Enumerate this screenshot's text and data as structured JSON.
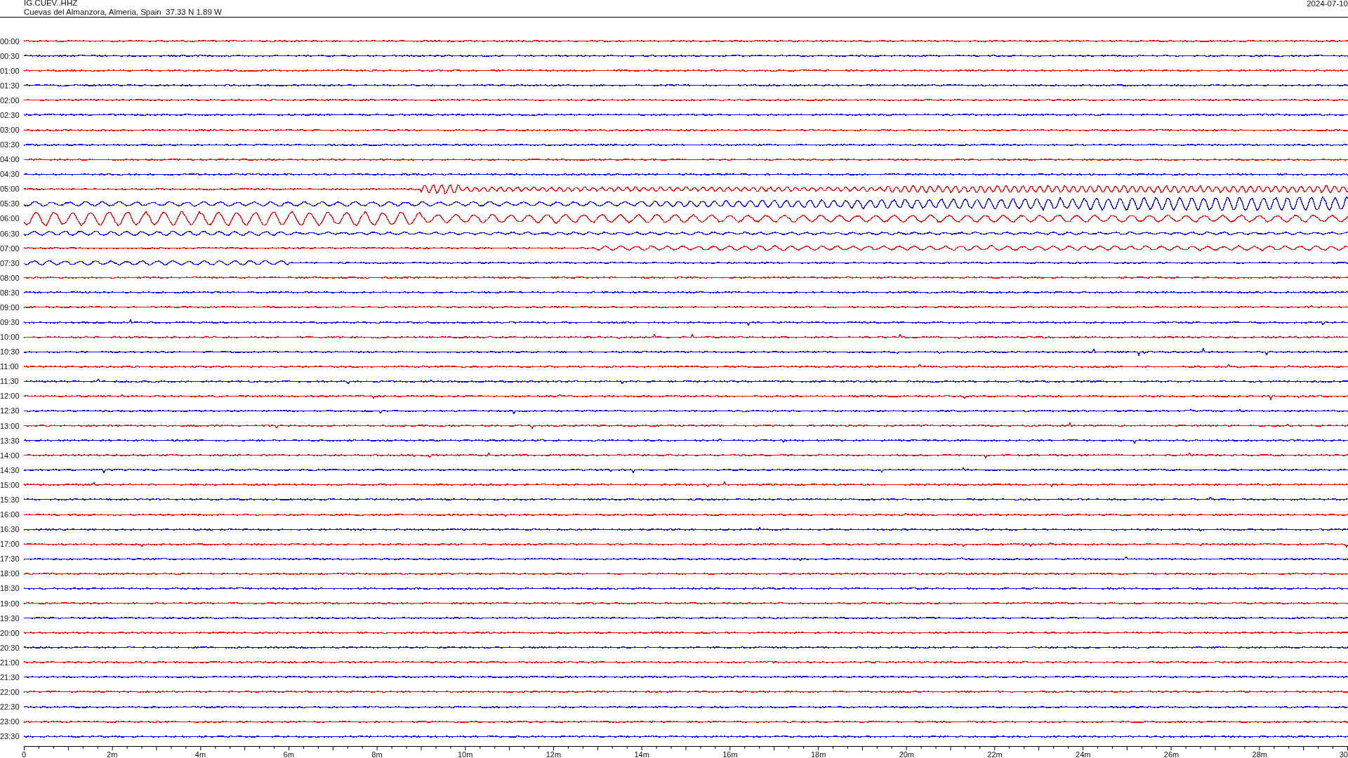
{
  "header": {
    "station": "IG.CUEV..HHZ",
    "location": "Cuevas del Almanzora, Almeria, Spain  37.33 N 1.89 W",
    "date": "2024-07-10"
  },
  "traces": [
    {
      "time": "00:00",
      "color": "#ff0000"
    },
    {
      "time": "00:30",
      "color": "#0000ff"
    },
    {
      "time": "01:00",
      "color": "#ff0000"
    },
    {
      "time": "01:30",
      "color": "#0000ff"
    },
    {
      "time": "02:00",
      "color": "#ff0000"
    },
    {
      "time": "02:30",
      "color": "#0000ff"
    },
    {
      "time": "03:00",
      "color": "#ff0000"
    },
    {
      "time": "03:30",
      "color": "#0000ff"
    },
    {
      "time": "04:00",
      "color": "#ff0000"
    },
    {
      "time": "04:30",
      "color": "#0000ff"
    },
    {
      "time": "05:00",
      "color": "#ff0000"
    },
    {
      "time": "05:30",
      "color": "#0000ff"
    },
    {
      "time": "06:00",
      "color": "#ff0000"
    },
    {
      "time": "06:30",
      "color": "#0000ff"
    },
    {
      "time": "07:00",
      "color": "#ff0000"
    },
    {
      "time": "07:30",
      "color": "#0000ff"
    },
    {
      "time": "08:00",
      "color": "#ff0000"
    },
    {
      "time": "08:30",
      "color": "#0000ff"
    },
    {
      "time": "09:00",
      "color": "#ff0000"
    },
    {
      "time": "09:30",
      "color": "#0000ff"
    },
    {
      "time": "10:00",
      "color": "#ff0000"
    },
    {
      "time": "10:30",
      "color": "#0000ff"
    },
    {
      "time": "11:00",
      "color": "#ff0000"
    },
    {
      "time": "11:30",
      "color": "#0000ff"
    },
    {
      "time": "12:00",
      "color": "#ff0000"
    },
    {
      "time": "12:30",
      "color": "#0000ff"
    },
    {
      "time": "13:00",
      "color": "#ff0000"
    },
    {
      "time": "13:30",
      "color": "#0000ff"
    },
    {
      "time": "14:00",
      "color": "#ff0000"
    },
    {
      "time": "14:30",
      "color": "#0000ff"
    },
    {
      "time": "15:00",
      "color": "#ff0000"
    },
    {
      "time": "15:30",
      "color": "#0000ff"
    },
    {
      "time": "16:00",
      "color": "#ff0000"
    },
    {
      "time": "16:30",
      "color": "#0000ff"
    },
    {
      "time": "17:00",
      "color": "#ff0000"
    },
    {
      "time": "17:30",
      "color": "#0000ff"
    },
    {
      "time": "18:00",
      "color": "#ff0000"
    },
    {
      "time": "18:30",
      "color": "#0000ff"
    },
    {
      "time": "19:00",
      "color": "#ff0000"
    },
    {
      "time": "19:30",
      "color": "#0000ff"
    },
    {
      "time": "20:00",
      "color": "#ff0000"
    },
    {
      "time": "20:30",
      "color": "#0000ff"
    },
    {
      "time": "21:00",
      "color": "#ff0000"
    },
    {
      "time": "21:30",
      "color": "#0000ff"
    },
    {
      "time": "22:00",
      "color": "#ff0000"
    },
    {
      "time": "22:30",
      "color": "#0000ff"
    },
    {
      "time": "23:00",
      "color": "#ff0000"
    },
    {
      "time": "23:30",
      "color": "#0000ff"
    }
  ],
  "axis": {
    "labels": [
      "0",
      "2m",
      "4m",
      "6m",
      "8m",
      "10m",
      "12m",
      "14m",
      "16m",
      "18m",
      "20m",
      "22m",
      "24m",
      "26m",
      "28m",
      "30"
    ]
  }
}
